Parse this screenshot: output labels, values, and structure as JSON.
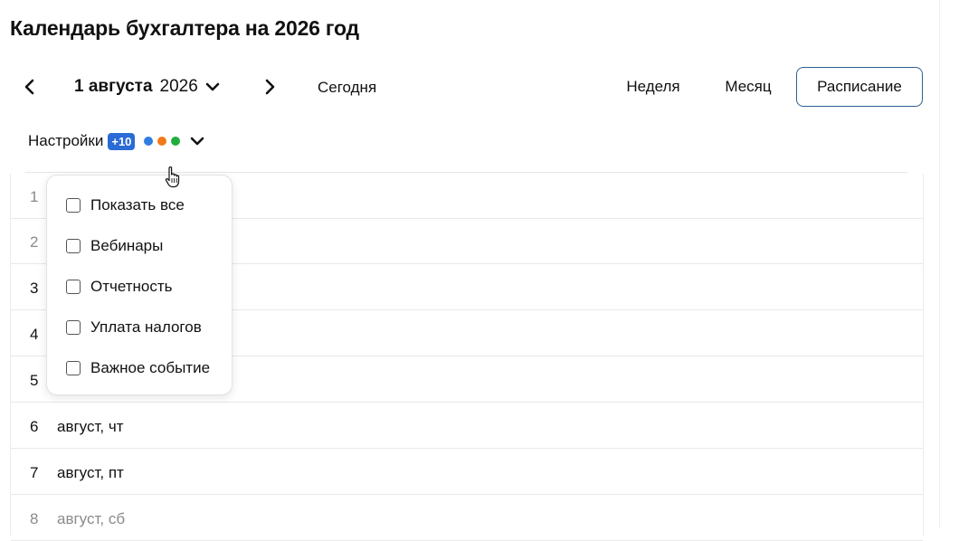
{
  "page": {
    "title": "Календарь бухгалтера на 2026 год"
  },
  "toolbar": {
    "date_day": "1 августа",
    "date_year": "2026",
    "today": "Сегодня",
    "views": [
      {
        "label": "Неделя",
        "active": false
      },
      {
        "label": "Месяц",
        "active": false
      },
      {
        "label": "Расписание",
        "active": true
      }
    ]
  },
  "settings": {
    "label": "Настройки",
    "badge": "+10",
    "dot_colors": [
      "#2f7de1",
      "#f07a1a",
      "#1fae3c"
    ]
  },
  "filter_menu": {
    "options": [
      {
        "label": "Показать все",
        "checked": false
      },
      {
        "label": "Вебинары",
        "checked": false
      },
      {
        "label": "Отчетность",
        "checked": false
      },
      {
        "label": "Уплата налогов",
        "checked": false
      },
      {
        "label": "Важное событие",
        "checked": false
      }
    ]
  },
  "schedule": {
    "rows": [
      {
        "num": "1",
        "label": "",
        "muted": true
      },
      {
        "num": "2",
        "label": "",
        "muted": true
      },
      {
        "num": "3",
        "label": "",
        "muted": false
      },
      {
        "num": "4",
        "label": "",
        "muted": false
      },
      {
        "num": "5",
        "label": "",
        "muted": false
      },
      {
        "num": "6",
        "label": "август, чт",
        "muted": false
      },
      {
        "num": "7",
        "label": "август, пт",
        "muted": false
      },
      {
        "num": "8",
        "label": "август, сб",
        "muted": true
      }
    ]
  },
  "colors": {
    "accent": "#2a6bd6",
    "active_border": "#2f5f8f"
  }
}
